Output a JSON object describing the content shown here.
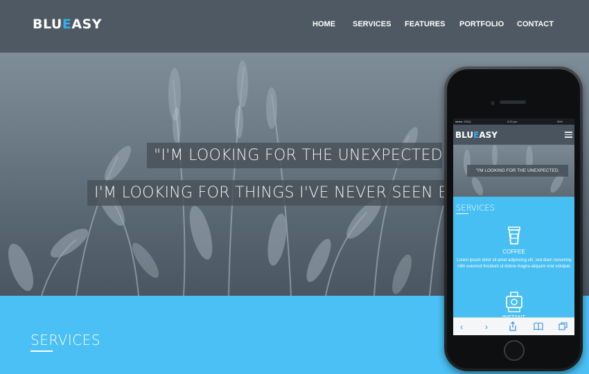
{
  "header": {
    "logo": {
      "part1": "BLU",
      "accent": "E",
      "part2": "ASY"
    },
    "nav": [
      "HOME",
      "SERVICES",
      "FEATURES",
      "PORTFOLIO",
      "CONTACT"
    ]
  },
  "hero": {
    "quote_line1": "\"I'M LOOKING FOR THE UNEXPECTED.",
    "quote_line2": "I'M LOOKING FOR THINGS I'VE NEVER SEEN BEF"
  },
  "services": {
    "title": "SERVICES"
  },
  "phone": {
    "status": {
      "carrier": "●●●●○ IDEA",
      "time": "9:20 pm",
      "battery": "90%"
    },
    "logo": {
      "part1": "BLU",
      "accent": "E",
      "part2": "ASY"
    },
    "quote": "\"I'M LOOKING FOR THE UNEXPECTED.",
    "services_title": "SERVICES",
    "coffee_title": "COFFEE",
    "coffee_text": "Lorem ipsum dolor sit amet adipiscing elit, sed diam nonummy nibh euismod tincidunt ut dolore magna aliquam erat volutpat.",
    "instant_title": "INSTANT",
    "toolbar": {
      "back": "‹",
      "forward": "›"
    }
  },
  "colors": {
    "accent": "#35aef0",
    "header_bg": "#4e5963",
    "services_bg": "#4ac0f4"
  }
}
